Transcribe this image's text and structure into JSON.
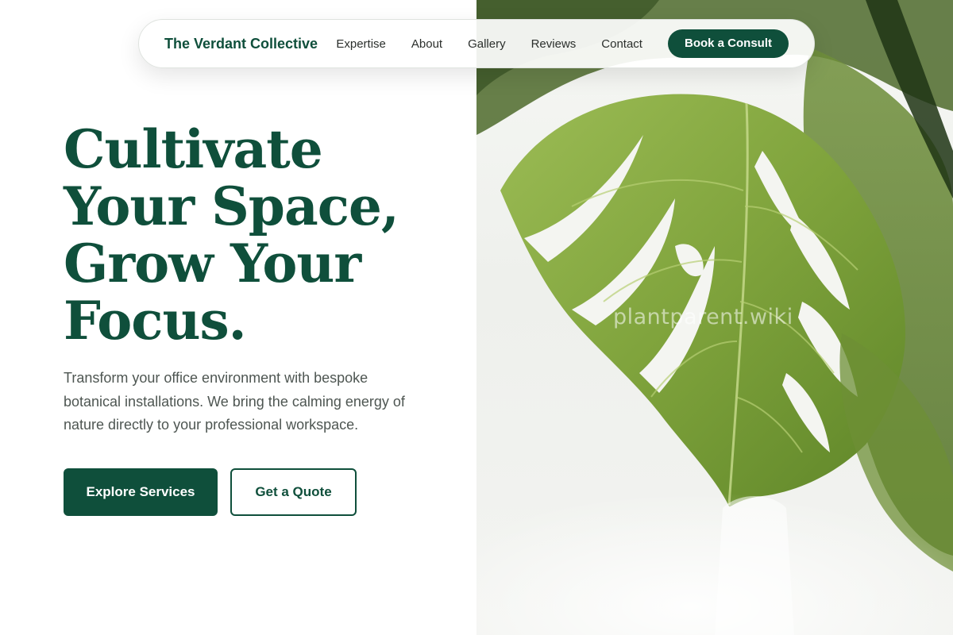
{
  "nav": {
    "brand": "The Verdant Collective",
    "links": [
      "Expertise",
      "About",
      "Gallery",
      "Reviews",
      "Contact"
    ],
    "cta_label": "Book a Consult"
  },
  "hero": {
    "title_lines": [
      "Cultivate",
      "Your Space,",
      "Grow Your",
      "Focus."
    ],
    "subtitle": "Transform your office environment with bespoke botanical installations. We bring the calming energy of nature directly to your professional workspace.",
    "primary_button": "Explore Services",
    "secondary_button": "Get a Quote",
    "image_watermark": "plantparent.wiki"
  },
  "colors": {
    "brand_green": "#0f4f3b",
    "body_text": "#4e5652",
    "leaf_green": "#7fa33c",
    "background": "#ffffff"
  }
}
